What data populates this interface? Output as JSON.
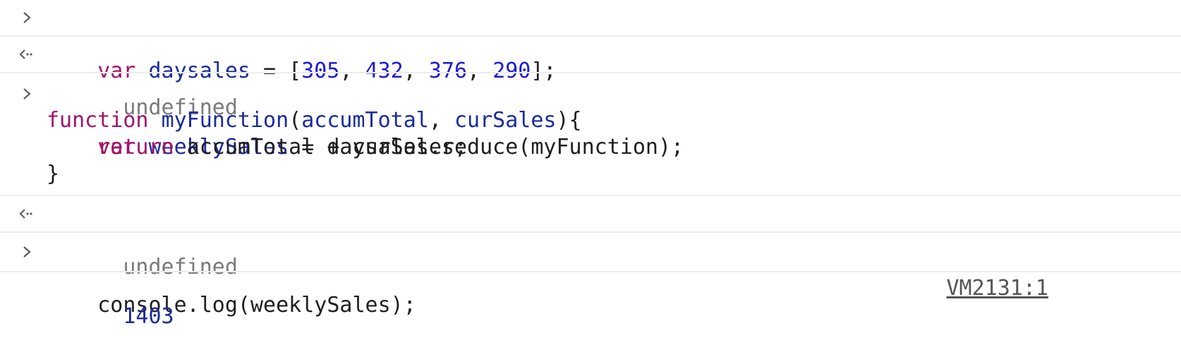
{
  "entries": [
    {
      "type": "input",
      "lines": [
        [
          {
            "t": "var",
            "c": "kw"
          },
          {
            "t": " ",
            "c": "plain"
          },
          {
            "t": "daysales",
            "c": "var"
          },
          {
            "t": " = [",
            "c": "plain"
          },
          {
            "t": "305",
            "c": "num"
          },
          {
            "t": ", ",
            "c": "plain"
          },
          {
            "t": "432",
            "c": "num"
          },
          {
            "t": ", ",
            "c": "plain"
          },
          {
            "t": "376",
            "c": "num"
          },
          {
            "t": ", ",
            "c": "plain"
          },
          {
            "t": "290",
            "c": "num"
          },
          {
            "t": "];",
            "c": "plain"
          }
        ]
      ]
    },
    {
      "type": "result",
      "text": "undefined"
    },
    {
      "type": "input",
      "lines": [
        [
          {
            "t": "var",
            "c": "kw"
          },
          {
            "t": " ",
            "c": "plain"
          },
          {
            "t": "weeklySales",
            "c": "var"
          },
          {
            "t": " = daysales.reduce(myFunction);",
            "c": "plain"
          }
        ],
        [
          {
            "t": "function",
            "c": "kw"
          },
          {
            "t": " ",
            "c": "plain"
          },
          {
            "t": "myFunction",
            "c": "var"
          },
          {
            "t": "(",
            "c": "plain"
          },
          {
            "t": "accumTotal",
            "c": "var"
          },
          {
            "t": ", ",
            "c": "plain"
          },
          {
            "t": "curSales",
            "c": "var"
          },
          {
            "t": "){",
            "c": "plain"
          }
        ],
        [
          {
            "t": "    ",
            "c": "plain"
          },
          {
            "t": "return",
            "c": "kw"
          },
          {
            "t": " accumTotal + curSales;",
            "c": "plain"
          }
        ],
        [
          {
            "t": "}",
            "c": "plain"
          }
        ]
      ]
    },
    {
      "type": "result",
      "text": "undefined"
    },
    {
      "type": "input",
      "lines": [
        [
          {
            "t": "console.log(weeklySales);",
            "c": "plain"
          }
        ]
      ]
    },
    {
      "type": "log",
      "value": "1403",
      "source": "VM2131:1"
    }
  ],
  "colors": {
    "keyword": "#a1146b",
    "variable": "#1a2b9c",
    "number": "#1c1cd6",
    "undefined": "#7a7a7a",
    "divider": "#ececec"
  },
  "icons": {
    "input_prompt": "chevron-right-icon",
    "result_prompt": "return-arrow-icon"
  }
}
